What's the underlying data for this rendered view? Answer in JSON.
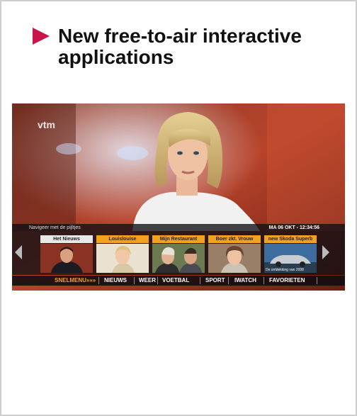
{
  "slide": {
    "title": "New free-to-air interactive applications"
  },
  "tv": {
    "logo": "vtm",
    "nav_hint": "Navigeer met de pijltjes",
    "datetime": "MA 06 OKT - 12:34:56",
    "tiles": [
      {
        "label": "Het Nieuws",
        "active": true
      },
      {
        "label": "Louislouise",
        "active": false
      },
      {
        "label": "Mijn Restaurant",
        "active": false
      },
      {
        "label": "Boer zkt. Vrouw",
        "active": false
      },
      {
        "label": "new Skoda Superb",
        "active": false,
        "caption": "De ontdekking van 2008"
      }
    ],
    "menu": [
      "SNELMENU",
      "NIEUWS",
      "WEER",
      "VOETBAL",
      "SPORT",
      "IWATCH",
      "FAVORIETEN"
    ],
    "menu_arrow": "»»»"
  },
  "colors": {
    "bullet": "#c8164a",
    "tile_label": "#f3a21d",
    "menu_highlight": "#f3a21d"
  }
}
